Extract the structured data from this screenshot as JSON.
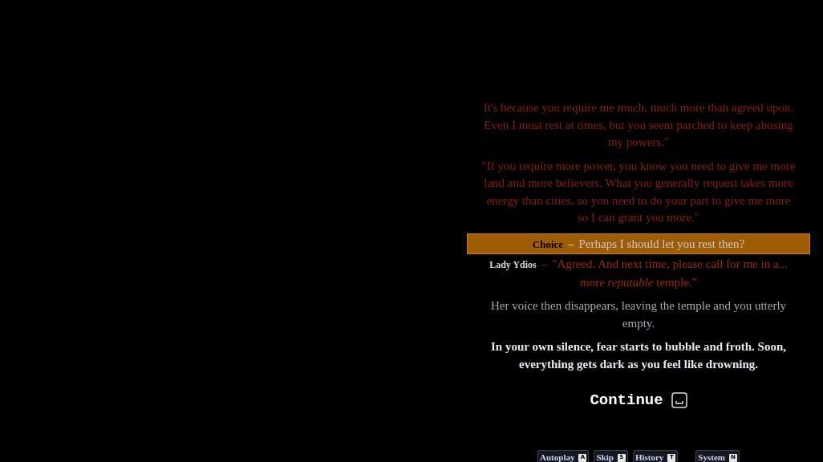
{
  "log": [
    {
      "kind": "quote",
      "text": "It's because you require me much, much more than agreed upon. Even I must rest at times, but you seem parched to keep abusing my powers.\""
    },
    {
      "kind": "quote",
      "text": "\"If you require more power, you know you need to give me more land and more believers. What you generally request takes more energy than cities, so you need to do your part to give me more so I can grant you more.\""
    },
    {
      "kind": "choice",
      "speaker": "Choice",
      "separator": "–",
      "text": "Perhaps I should let you rest then?"
    },
    {
      "kind": "speech",
      "speaker": "Lady Ydios",
      "separator": "–",
      "text": "\"Agreed. And next time, please call for me in a... more *reputable* temple.\""
    },
    {
      "kind": "past",
      "text": "Her voice then disappears, leaving the temple and you utterly empty."
    },
    {
      "kind": "current",
      "text": "In your own silence, fear starts to bubble and froth. Soon, everything gets dark as you feel like drowning."
    }
  ],
  "continue": {
    "label": "Continue"
  },
  "menu": [
    {
      "label": "Autoplay",
      "key": "A"
    },
    {
      "label": "Skip",
      "key": "S"
    },
    {
      "label": "History",
      "key": "T"
    },
    {
      "label": "System",
      "key": "N"
    }
  ]
}
